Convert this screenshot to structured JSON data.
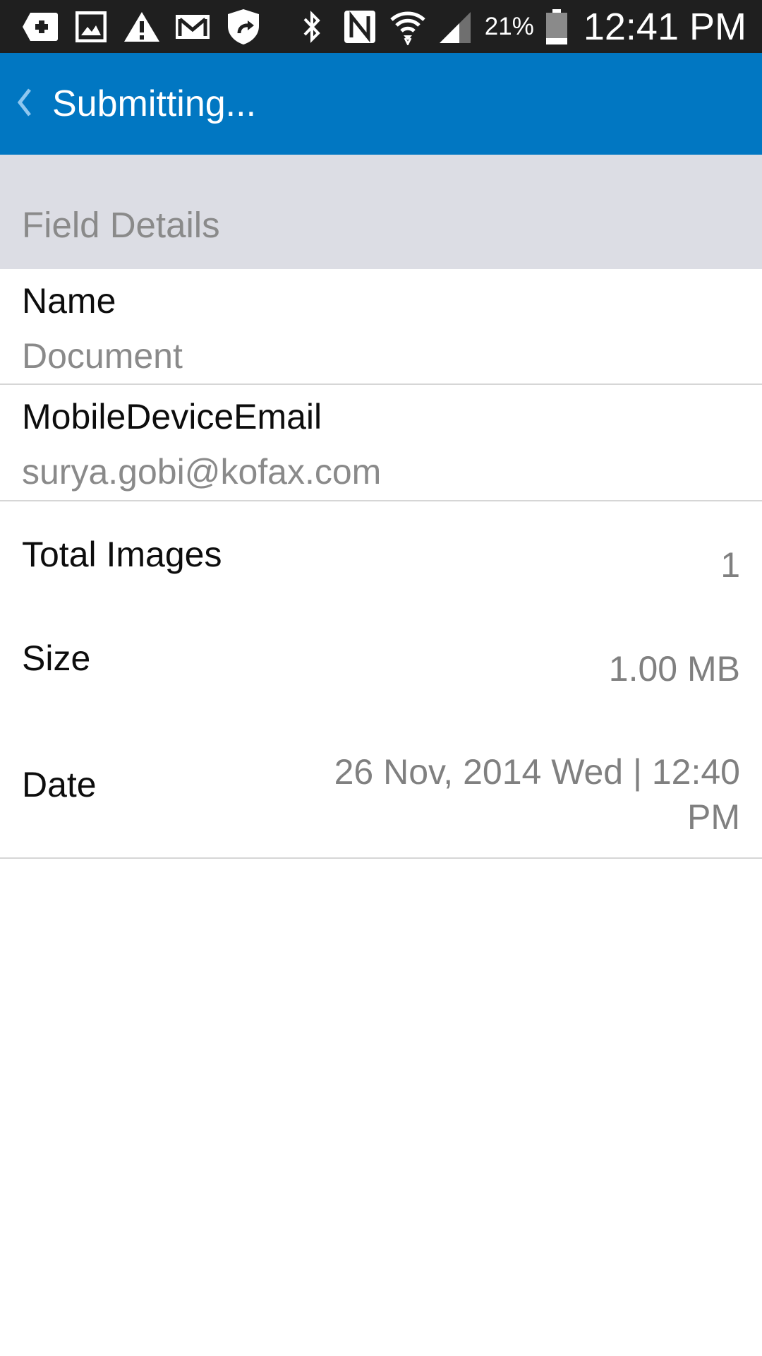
{
  "status_bar": {
    "icons_left": [
      "add-box-icon",
      "gallery-icon",
      "warning-icon",
      "gmail-icon",
      "shield-sync-icon"
    ],
    "icons_right": [
      "bluetooth-icon",
      "nfc-icon",
      "wifi-icon",
      "signal-icon",
      "battery-icon"
    ],
    "battery_percent": "21%",
    "battery_level": 0.21,
    "time": "12:41 PM"
  },
  "app_bar": {
    "back_icon": "chevron-left-icon",
    "title": "Submitting...",
    "background": "#0177c2"
  },
  "section": {
    "title": "Field Details"
  },
  "fields": [
    {
      "label": "Name",
      "value": "Document"
    },
    {
      "label": "MobileDeviceEmail",
      "value": "surya.gobi@kofax.com"
    }
  ],
  "info": {
    "total_images": {
      "label": "Total Images",
      "value": "1"
    },
    "size": {
      "label": "Size",
      "value": "1.00 MB"
    },
    "date": {
      "label": "Date",
      "value_line1": "26 Nov, 2014 Wed | 12:40",
      "value_line2": "PM"
    }
  }
}
